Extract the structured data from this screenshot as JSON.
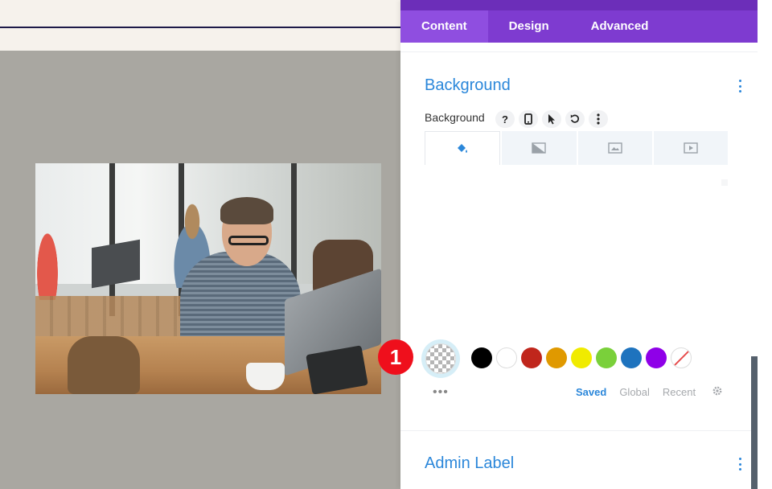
{
  "panel": {
    "tabs": [
      {
        "label": "Content"
      },
      {
        "label": "Design"
      },
      {
        "label": "Advanced"
      }
    ]
  },
  "background_section": {
    "title": "Background",
    "field_label": "Background",
    "help_icon": "?"
  },
  "swatches": {
    "colors": [
      "#000000",
      "#ffffff",
      "#c0261c",
      "#e09900",
      "#f0eb00",
      "#7ad03a",
      "#1e73be",
      "#8f00e8"
    ],
    "more": "•••",
    "palette_tabs": [
      "Saved",
      "Global",
      "Recent"
    ]
  },
  "admin_section": {
    "title": "Admin Label"
  },
  "step_marker": "1",
  "accent_color": "#2b87da",
  "tab_bar_color": "#7e3bd0"
}
